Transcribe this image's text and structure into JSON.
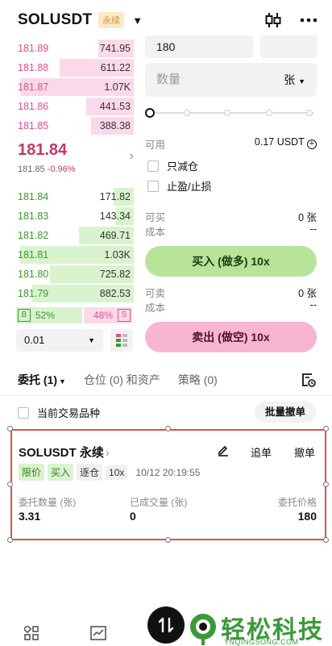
{
  "header": {
    "symbol": "SOLUSDT",
    "badge": "永续"
  },
  "orderbook": {
    "asks": [
      {
        "price": "181.89",
        "qty": "741.95",
        "depth": 0.3
      },
      {
        "price": "181.88",
        "qty": "611.22",
        "depth": 0.62
      },
      {
        "price": "181.87",
        "qty": "1.07K",
        "depth": 0.95
      },
      {
        "price": "181.86",
        "qty": "441.53",
        "depth": 0.4
      },
      {
        "price": "181.85",
        "qty": "388.38",
        "depth": 0.36
      }
    ],
    "last_price": "181.84",
    "mark_price": "181.85",
    "change_pct": "-0.96%",
    "bids": [
      {
        "price": "181.84",
        "qty": "171.82",
        "depth": 0.17
      },
      {
        "price": "181.83",
        "qty": "143.34",
        "depth": 0.15
      },
      {
        "price": "181.82",
        "qty": "469.71",
        "depth": 0.46
      },
      {
        "price": "181.81",
        "qty": "1.03K",
        "depth": 0.95
      },
      {
        "price": "181.80",
        "qty": "725.82",
        "depth": 0.7
      },
      {
        "price": "181.79",
        "qty": "882.53",
        "depth": 0.85
      }
    ],
    "buy_label": "B",
    "buy_pct": "52%",
    "sell_label": "S",
    "sell_pct": "48%",
    "tick_size": "0.01"
  },
  "form": {
    "price_value": "180",
    "qty_placeholder": "数量",
    "qty_unit": "张",
    "available_label": "可用",
    "available_value": "0.17 USDT",
    "reduce_only": "只减仓",
    "tp_sl": "止盈/止损",
    "can_buy_label": "可买",
    "can_buy_value": "0 张",
    "cost_label": "成本",
    "cost_value": "--",
    "buy_button": "买入 (做多) 10x",
    "can_sell_label": "可卖",
    "can_sell_value": "0 张",
    "cost2_label": "成本",
    "cost2_value": "--",
    "sell_button": "卖出 (做空) 10x"
  },
  "tabs": [
    {
      "label": "委托 (1)",
      "active": true
    },
    {
      "label": "仓位 (0) 和资产",
      "active": false
    },
    {
      "label": "策略 (0)",
      "active": false
    }
  ],
  "filter": {
    "current_only": "当前交易品种",
    "cancel_all": "批量撤单"
  },
  "order": {
    "symbol": "SOLUSDT 永续",
    "chase": "追单",
    "cancel": "撤单",
    "tags": [
      "限价",
      "买入",
      "逐仓",
      "10x"
    ],
    "time": "10/12 20:19:55",
    "cols": [
      {
        "label": "委托数量 (张)",
        "value": "3.31"
      },
      {
        "label": "已成交量 (张)",
        "value": "0"
      },
      {
        "label": "委托价格",
        "value": "180"
      }
    ]
  },
  "watermark": {
    "text": "轻松科技",
    "url": "YNQINGSONG.COM"
  },
  "colors": {
    "ask": "#fbd9ea",
    "bid": "#d9f3cf",
    "buy_button": "#b8e49a",
    "sell_button": "#f8b5d0",
    "highlight": "#e0504a"
  }
}
